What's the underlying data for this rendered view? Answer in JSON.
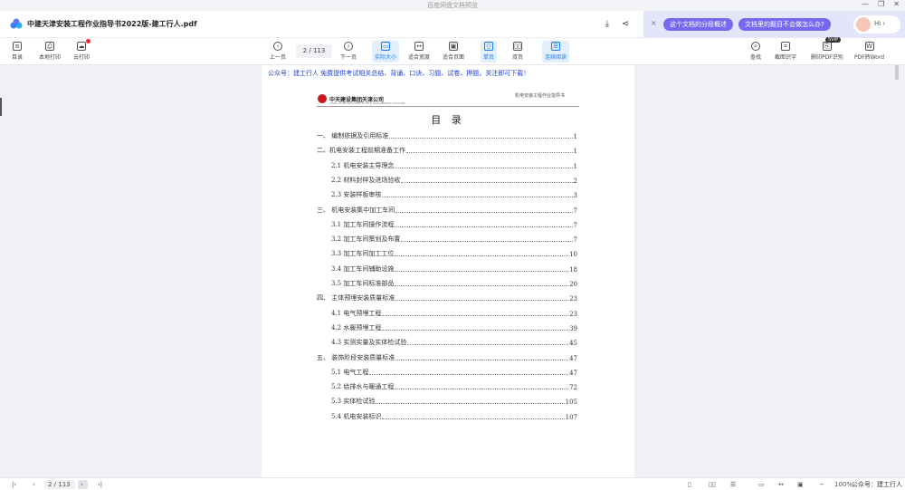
{
  "window": {
    "title": "百度网盘文档预览",
    "controls": [
      "—",
      "❐",
      "✕"
    ]
  },
  "header": {
    "filename": "中建天津安装工程作业指导书2022版-建工行人.pdf"
  },
  "ai": {
    "prompt1": "这个文档的分段概述",
    "prompt2": "文档里的题目不会做怎么办?",
    "greeting": "Hi ›",
    "close": "×"
  },
  "toolbar": {
    "catalog": "目录",
    "local_print": "本地打印",
    "cloud_print": "云打印",
    "prev": "上一页",
    "page_indicator": "2 / 113",
    "next": "下一页",
    "actual_size": "实际大小",
    "fit_width": "适合宽度",
    "fit_page": "适合页面",
    "single": "单页",
    "double": "双页",
    "continuous": "连续阅读",
    "find": "查找",
    "ocr": "截图识字",
    "pdf_split": "删印PDF识别",
    "pdf_word": "PDF转Word",
    "svip": "SVIP"
  },
  "document": {
    "banner": "公众号：建工行人 免费提供考试相关总结、背诵、口诀、习题、试卷、押题，关注即可下载！",
    "company": "中天建设集团天津公司",
    "company_sub": "CHINA CONSTRUCTION EIGHTH ENGINEERING DIVISION",
    "header_right": "机电安装工程作业指导书",
    "toc_title": "目 录",
    "toc": [
      {
        "label": "一、 编制依据及引用标准",
        "page": "1"
      },
      {
        "label": "二、机电安装工程前期准备工作",
        "page": "1"
      },
      {
        "label": "2.1 机电安装主导理念",
        "page": "1"
      },
      {
        "label": "2.2 材料封样及进场验收",
        "page": "2"
      },
      {
        "label": "2.3 安装样板审核",
        "page": "3"
      },
      {
        "label": "三、 机电安装集中加工车间",
        "page": "7"
      },
      {
        "label": "3.1 加工车间操作流程",
        "page": "7"
      },
      {
        "label": "3.2 加工车间策划及布置",
        "page": "7"
      },
      {
        "label": "3.3 加工车间加工工位",
        "page": "10"
      },
      {
        "label": "3.4 加工车间辅助设施",
        "page": "18"
      },
      {
        "label": "3.5 加工车间标准部品",
        "page": "20"
      },
      {
        "label": "四、 主体预埋安装质量标准",
        "page": "23"
      },
      {
        "label": "4.1 电气预埋工程",
        "page": "23"
      },
      {
        "label": "4.2 水暖预埋工程",
        "page": "39"
      },
      {
        "label": "4.3 实测实量及实体检试验",
        "page": "45"
      },
      {
        "label": "五、 装饰阶段安装质量标准",
        "page": "47"
      },
      {
        "label": "5.1 电气工程",
        "page": "47"
      },
      {
        "label": "5.2 给排水与暖通工程",
        "page": "72"
      },
      {
        "label": "5.3 实体检试验",
        "page": "105"
      },
      {
        "label": "5.4 机电安装标识",
        "page": "107"
      }
    ]
  },
  "bottombar": {
    "page_indicator": "2 / 113",
    "zoom": "100%",
    "watermark": "公众号：建工行人"
  }
}
